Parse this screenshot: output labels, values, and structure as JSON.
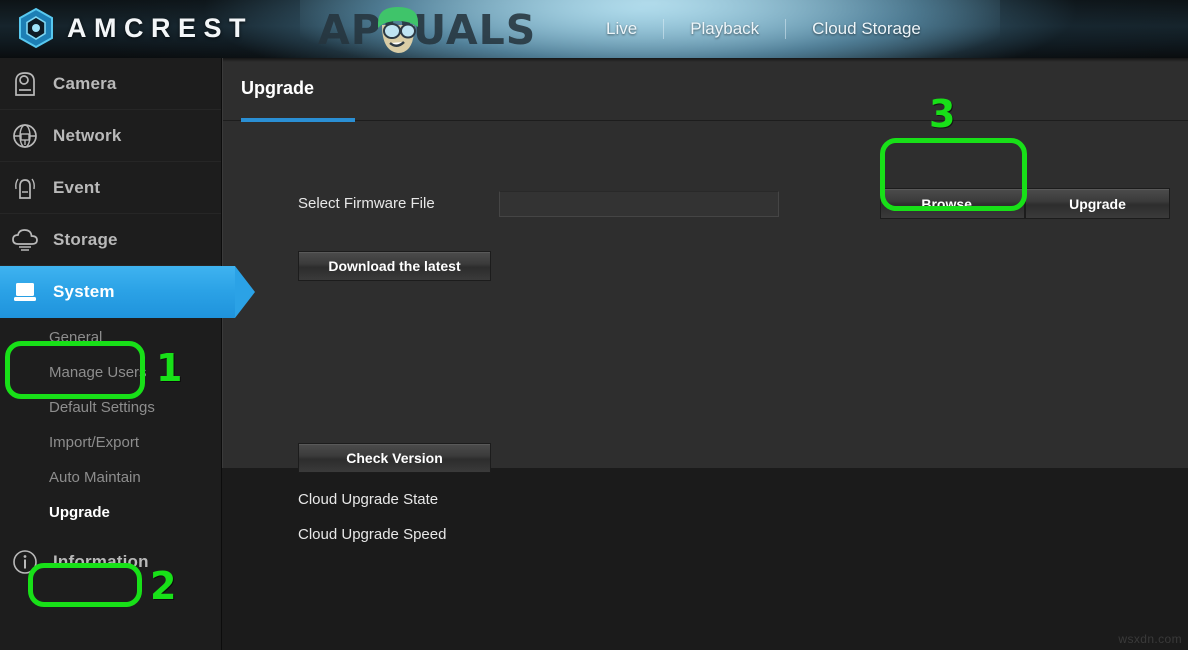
{
  "brand": {
    "name": "AMCREST",
    "logo_icon": "amcrest-hexagon-logo",
    "watermark_text": "APPUALS",
    "watermark_logo_icon": "appuals-mascot-icon"
  },
  "topnav": {
    "items": [
      {
        "label": "Live",
        "icon": "live-icon"
      },
      {
        "label": "Playback",
        "icon": "playback-icon"
      },
      {
        "label": "Cloud Storage",
        "icon": "cloud-storage-icon"
      }
    ]
  },
  "sidebar": {
    "items": [
      {
        "label": "Camera",
        "icon": "camera-icon",
        "active": false
      },
      {
        "label": "Network",
        "icon": "network-globe-icon",
        "active": false
      },
      {
        "label": "Event",
        "icon": "event-alarm-icon",
        "active": false
      },
      {
        "label": "Storage",
        "icon": "storage-cloud-icon",
        "active": false
      },
      {
        "label": "System",
        "icon": "system-monitor-icon",
        "active": true
      }
    ],
    "sub_items": [
      {
        "label": "General",
        "current": false
      },
      {
        "label": "Manage Users",
        "current": false
      },
      {
        "label": "Default Settings",
        "current": false
      },
      {
        "label": "Import/Export",
        "current": false
      },
      {
        "label": "Auto Maintain",
        "current": false
      },
      {
        "label": "Upgrade",
        "current": true
      }
    ],
    "footer_item": {
      "label": "Information",
      "icon": "information-circle-icon"
    }
  },
  "main": {
    "tab": {
      "label": "Upgrade",
      "active": true
    },
    "accent_color": "#2a8fd4",
    "firmware": {
      "label": "Select Firmware File",
      "input_value": "",
      "input_placeholder": "",
      "browse_button": "Browse...",
      "upgrade_button": "Upgrade",
      "download_button": "Download the latest"
    },
    "cloud": {
      "check_version_button": "Check Version",
      "state_label": "Cloud Upgrade State",
      "state_value": "",
      "speed_label": "Cloud Upgrade Speed",
      "speed_value": ""
    }
  },
  "annotations": {
    "color": "#18e018",
    "markers": [
      {
        "number": "1",
        "target": "sidebar-item-system"
      },
      {
        "number": "2",
        "target": "sidebar-subitem-upgrade"
      },
      {
        "number": "3",
        "target": "browse-button"
      }
    ]
  },
  "footer": {
    "watermark": "wsxdn.com"
  }
}
